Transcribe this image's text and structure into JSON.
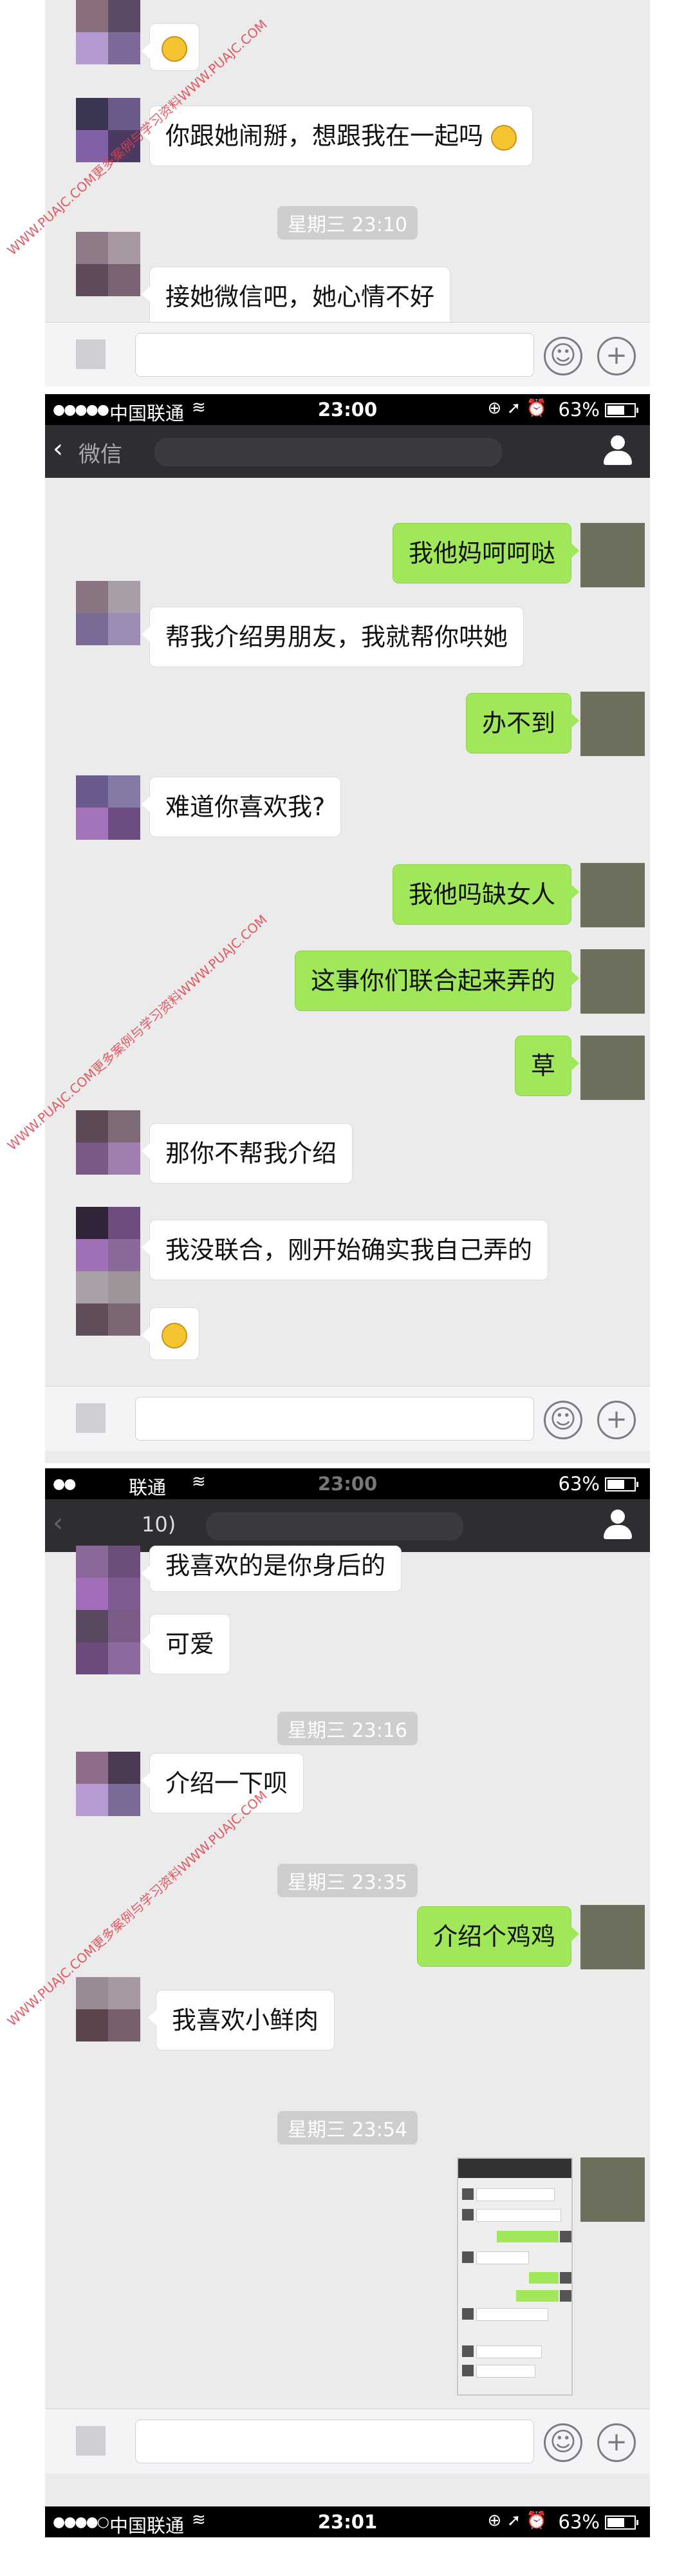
{
  "status": {
    "carrier": "中国联通",
    "carrier_partial": "联通",
    "time": "23:00",
    "time_partial": "23:00",
    "time_bottom": "23:01",
    "battery": "63%"
  },
  "nav": {
    "back_label": "微信",
    "title_fragment": "10)"
  },
  "panel1": {
    "messages": [
      {
        "side": "left",
        "text": "你跟她闹掰，想跟我在一起吗"
      },
      {
        "side": "left",
        "text": "接她微信吧，她心情不好"
      }
    ],
    "timestamp": "星期三 23:10"
  },
  "panel2": {
    "messages": [
      {
        "side": "right",
        "text": "我他妈呵呵哒"
      },
      {
        "side": "left",
        "text": "帮我介绍男朋友，我就帮你哄她"
      },
      {
        "side": "right",
        "text": "办不到"
      },
      {
        "side": "left",
        "text": "难道你喜欢我?"
      },
      {
        "side": "right",
        "text": "我他吗缺女人"
      },
      {
        "side": "right",
        "text": "这事你们联合起来弄的"
      },
      {
        "side": "right",
        "text": "草"
      },
      {
        "side": "left",
        "text": "那你不帮我介绍"
      },
      {
        "side": "left",
        "text": "我没联合，刚开始确实我自己弄的"
      }
    ]
  },
  "panel3": {
    "messages": [
      {
        "side": "left",
        "text": "我喜欢的是你身后的"
      },
      {
        "side": "left",
        "text": "可爱"
      },
      {
        "side": "left",
        "text": "介绍一下呗"
      },
      {
        "side": "right",
        "text": "介绍个鸡鸡"
      },
      {
        "side": "left",
        "text": "我喜欢小鲜肉"
      }
    ],
    "timestamps": [
      "星期三 23:16",
      "星期三 23:35",
      "星期三 23:54"
    ]
  },
  "watermark": "WWW.PUAJC.COM更多案例与学习资料WWW.PUAJC.COM",
  "colors": {
    "my_bubble": "#a0e759",
    "their_bubble": "#ffffff",
    "nav_bg": "#2d2d32",
    "chat_bg": "#ebebeb"
  }
}
